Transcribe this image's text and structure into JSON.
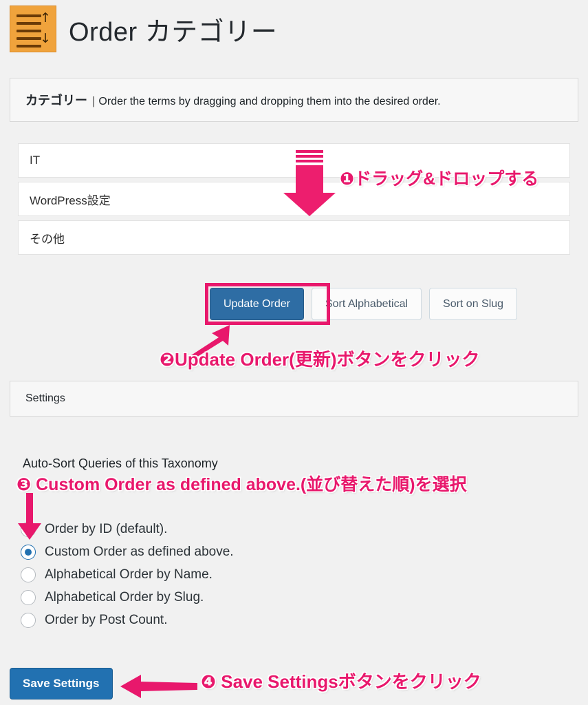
{
  "page": {
    "title": "Order カテゴリー",
    "icon": "order-list-updown-icon",
    "background_color": "#f1f1f1",
    "accent_blue": "#2e6da4",
    "accent_pink": "#e8186c",
    "icon_color": "#f0a33c"
  },
  "taxonomy_bar": {
    "label": "カテゴリー",
    "separator": "|",
    "description": "Order the terms by dragging and dropping them into the desired order."
  },
  "terms": [
    {
      "name": "IT"
    },
    {
      "name": "WordPress設定"
    },
    {
      "name": "その他"
    }
  ],
  "buttons": {
    "update_order": "Update Order",
    "sort_alphabetical": "Sort Alphabetical",
    "sort_on_slug": "Sort on Slug"
  },
  "settings_bar": {
    "label": "Settings"
  },
  "autosort": {
    "title": "Auto-Sort Queries of this Taxonomy",
    "options": [
      {
        "label": "Order by ID (default).",
        "selected": false
      },
      {
        "label": "Custom Order as defined above.",
        "selected": true
      },
      {
        "label": "Alphabetical Order by Name.",
        "selected": false
      },
      {
        "label": "Alphabetical Order by Slug.",
        "selected": false
      },
      {
        "label": "Order by Post Count.",
        "selected": false
      }
    ]
  },
  "save": {
    "label": "Save Settings"
  },
  "annotations": {
    "step1": "❶ドラッグ&ドロップする",
    "step2": "❷Update Order(更新)ボタンをクリック",
    "step3": "❸ Custom Order as defined above.(並び替えた順)を選択",
    "step4": "❹ Save Settingsボタンをクリック"
  }
}
